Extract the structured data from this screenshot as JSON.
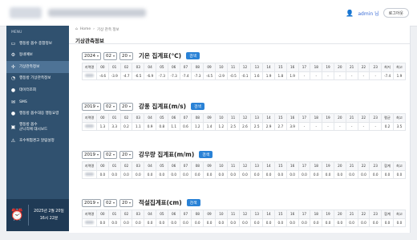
{
  "header": {
    "user_name": "admin 님",
    "logout_label": "로그아웃"
  },
  "sidebar": {
    "caption": "MENU",
    "items": [
      {
        "label": "행동방 옵수 종합정보",
        "icon": "monitor-icon"
      },
      {
        "label": "동네예보",
        "icon": "gear-icon"
      },
      {
        "label": "기상관측정보",
        "icon": "fan-icon"
      },
      {
        "label": "행동방 기상관측정보",
        "icon": "chart-icon"
      },
      {
        "label": "데이터조회",
        "icon": "circle-icon"
      },
      {
        "label": "SMS",
        "icon": "sms-icon"
      },
      {
        "label": "행동방 옵수대응 행동요령",
        "icon": "person-icon"
      },
      {
        "label": "행동방 옵수\n군니리에 대시보드",
        "icon": "dashboard-icon"
      },
      {
        "label": "호수위험경고 알림설정",
        "icon": "alarm-icon"
      }
    ],
    "clock": {
      "date": "2025년 2월 20일",
      "time": "16시 22분"
    }
  },
  "breadcrumb": {
    "home": "Home",
    "current": "기상 관측 정보"
  },
  "page_title": "기상관측정보",
  "search_label": "검색",
  "sections": [
    {
      "year": "2024",
      "month": "02",
      "day": "20",
      "title": "기온 집계표(℃)",
      "head": [
        "지역명",
        "00",
        "01",
        "02",
        "03",
        "04",
        "05",
        "06",
        "07",
        "08",
        "09",
        "10",
        "11",
        "12",
        "13",
        "14",
        "15",
        "16",
        "17",
        "18",
        "19",
        "20",
        "21",
        "22",
        "23",
        "최저",
        "최고"
      ],
      "row": [
        "",
        "-4.6",
        "-3.9",
        "-4.7",
        "-6.5",
        "-6.9",
        "-7.3",
        "-7.3",
        "-7.4",
        "-7.3",
        "-4.5",
        "-2.9",
        "-0.5",
        "-0.1",
        "1.6",
        "1.9",
        "1.8",
        "1.9",
        "-",
        "-",
        "-",
        "-",
        "-",
        "-",
        "-",
        "-7.4",
        "1.9"
      ]
    },
    {
      "year": "2019",
      "month": "02",
      "day": "20",
      "title": "강풍 집계표(m/s)",
      "head": [
        "지역명",
        "00",
        "01",
        "02",
        "03",
        "04",
        "05",
        "06",
        "07",
        "08",
        "09",
        "10",
        "11",
        "12",
        "13",
        "14",
        "15",
        "16",
        "17",
        "18",
        "19",
        "20",
        "21",
        "22",
        "23",
        "평균",
        "최고"
      ],
      "row": [
        "",
        "1.3",
        "3.3",
        "0.2",
        "1.1",
        "0.9",
        "0.8",
        "1.1",
        "0.6",
        "1.2",
        "1.4",
        "1.2",
        "2.5",
        "2.6",
        "2.5",
        "2.9",
        "2.7",
        "3.9",
        "-",
        "-",
        "-",
        "-",
        "-",
        "-",
        "-",
        "0.2",
        "3.5"
      ]
    },
    {
      "year": "2019",
      "month": "02",
      "day": "20",
      "title": "강우량 집계표(m/m)",
      "head": [
        "지역명",
        "00",
        "01",
        "02",
        "03",
        "04",
        "05",
        "06",
        "07",
        "08",
        "09",
        "10",
        "11",
        "12",
        "13",
        "14",
        "15",
        "16",
        "17",
        "18",
        "19",
        "20",
        "21",
        "22",
        "23",
        "합계",
        "최고"
      ],
      "row": [
        "",
        "0.0",
        "0.0",
        "0.0",
        "0.0",
        "0.0",
        "0.0",
        "0.0",
        "0.0",
        "0.0",
        "0.0",
        "0.0",
        "0.0",
        "0.0",
        "0.0",
        "0.0",
        "0.0",
        "0.0",
        "0.0",
        "0.0",
        "0.0",
        "0.0",
        "0.0",
        "0.0",
        "0.0",
        "0.0",
        "0.0"
      ]
    },
    {
      "year": "2019",
      "month": "02",
      "day": "20",
      "title": "적설집계표(cm)",
      "head": [
        "지역명",
        "00",
        "01",
        "02",
        "03",
        "04",
        "05",
        "06",
        "07",
        "08",
        "09",
        "10",
        "11",
        "12",
        "13",
        "14",
        "15",
        "16",
        "17",
        "18",
        "19",
        "20",
        "21",
        "22",
        "23",
        "합계",
        "최고"
      ],
      "row": [
        "",
        "0.0",
        "0.0",
        "0.0",
        "0.0",
        "0.0",
        "0.0",
        "0.0",
        "0.0",
        "0.0",
        "0.0",
        "0.0",
        "0.0",
        "0.0",
        "0.0",
        "0.0",
        "0.0",
        "0.0",
        "0.0",
        "0.0",
        "0.0",
        "0.0",
        "0.0",
        "0.0",
        "0.0",
        "0.0",
        "0.0"
      ]
    }
  ]
}
